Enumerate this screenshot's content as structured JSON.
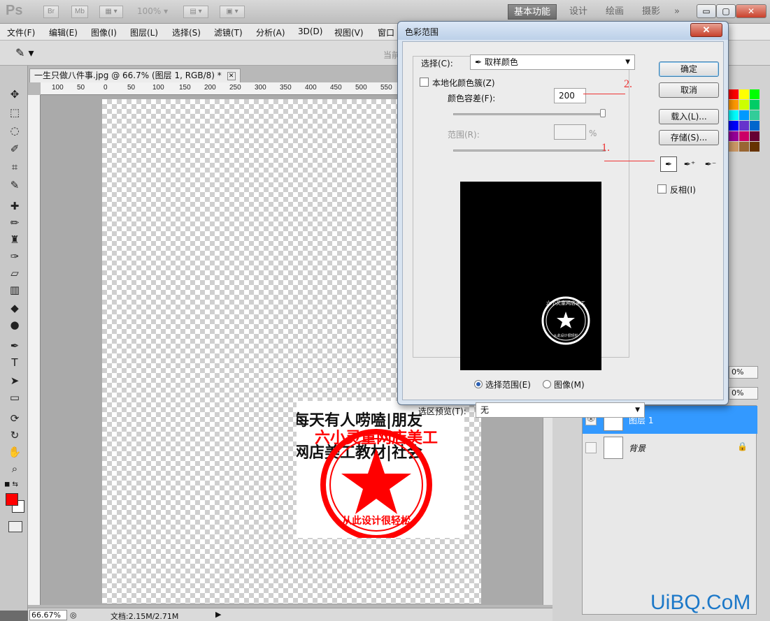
{
  "app": {
    "logo": "Ps",
    "bridge_btn": "Br",
    "minibridge_btn": "Mb",
    "zoom_preset": "100%",
    "workspaces": [
      "基本功能",
      "设计",
      "绘画",
      "摄影"
    ],
    "more": "»",
    "window_controls": {
      "minimize": "▭",
      "maximize": "▢",
      "close": "✕"
    }
  },
  "menu": [
    "文件(F)",
    "编辑(E)",
    "图像(I)",
    "图层(L)",
    "选择(S)",
    "滤镜(T)",
    "分析(A)",
    "3D(D)",
    "视图(V)",
    "窗口"
  ],
  "options": {
    "current_label": "当前"
  },
  "document": {
    "tab_title": "一生只做八件事.jpg @ 66.7% (图层 1, RGB/8) *",
    "tab_close": "✕",
    "ruler_numbers": [
      "100",
      "50",
      "0",
      "50",
      "100",
      "150",
      "200",
      "250",
      "300",
      "350",
      "400",
      "450",
      "500",
      "550"
    ],
    "canvas_text": [
      "每天有人唠嗑|朋友",
      "网店美工教材|社会"
    ],
    "stamp": {
      "arc_text": "六小灵童网店美工",
      "bottom_text": "从此设计很轻松",
      "color": "#ff0000"
    },
    "zoom": "66.67%",
    "doc_size": "文档:2.15M/2.71M"
  },
  "layers": {
    "opacity_pct": "0%",
    "fill_pct": "0%",
    "items": [
      {
        "name": "图层 1",
        "selected": true,
        "visible": true
      },
      {
        "name": "背景",
        "selected": false,
        "visible": false
      }
    ]
  },
  "swatches": [
    "#ff0000",
    "#ffff00",
    "#00ff00",
    "#ff9900",
    "#ccff00",
    "#00cc66",
    "#00ffff",
    "#0099ff",
    "#33cc99",
    "#0000ff",
    "#6633cc",
    "#0066cc",
    "#990099",
    "#cc0066",
    "#660033",
    "#cc9966",
    "#996633",
    "#663300"
  ],
  "dialog": {
    "title": "色彩范围",
    "close": "✕",
    "select_label": "选择(C):",
    "select_value": "取样颜色",
    "localized_label": "本地化颜色簇(Z)",
    "fuzziness_label": "颜色容差(F):",
    "fuzziness_value": "200",
    "range_label": "范围(R):",
    "range_unit": "%",
    "preview_radio": {
      "selection": "选择范围(E)",
      "image": "图像(M)"
    },
    "selection_preview_label": "选区预览(T):",
    "selection_preview_value": "无",
    "buttons": {
      "ok": "确定",
      "cancel": "取消",
      "load": "载入(L)...",
      "save": "存储(S)..."
    },
    "invert_label": "反相(I)",
    "preview_stamp": {
      "arc_text": "六小灵童网店美工",
      "bottom_text": "从此设计很轻松"
    }
  },
  "annotations": {
    "one": "1.",
    "two": "2."
  },
  "watermark": "UiBQ.CoM"
}
